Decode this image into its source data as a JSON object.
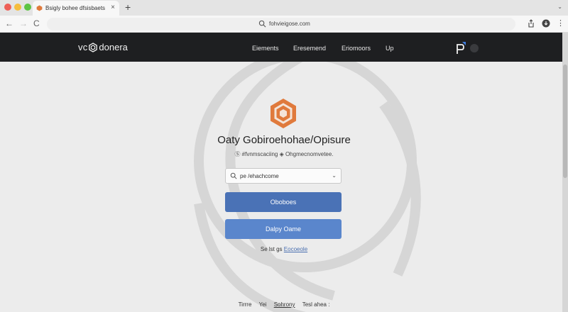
{
  "browser": {
    "tab_title": "Bsigly bohee dfsisbaets",
    "tab_close": "×",
    "new_tab": "+",
    "tab_menu": "⌄",
    "url": "fohvieigose.com",
    "back": "←",
    "forward": "→",
    "reload": "C",
    "more": "⋮"
  },
  "header": {
    "logo_prefix": "vc",
    "logo_suffix": "donera",
    "nav": [
      "Eiements",
      "Eresemend",
      "Eriomoors",
      "Up"
    ]
  },
  "hero": {
    "title": "Oaty Gobiroehohae/Opisure",
    "subtitle": "Ⓢ #fvnmscaciing ◈ Ohgmecnomvetee."
  },
  "form": {
    "select_value": "pe /ehachcome",
    "select_chevron": "⌄",
    "primary_button": "Oboboes",
    "secondary_button": "Dalpy Oame",
    "signin_text": "Se lst gs",
    "signin_link": "Eocoeole"
  },
  "footer": {
    "links": [
      "Tirrre",
      "Yei",
      "Sohrony",
      "Tesl ahea :"
    ]
  },
  "colors": {
    "header_bg": "#1e1f21",
    "brand_orange": "#e07a3c",
    "primary_blue": "#4a72b6",
    "secondary_blue": "#5a86cc"
  },
  "icons": {
    "tab_favicon": "hexagon-logo-icon",
    "omnibox": "search-icon",
    "share": "share-icon",
    "download": "download-icon",
    "header": "profile-app-icon",
    "select": "search-icon"
  }
}
